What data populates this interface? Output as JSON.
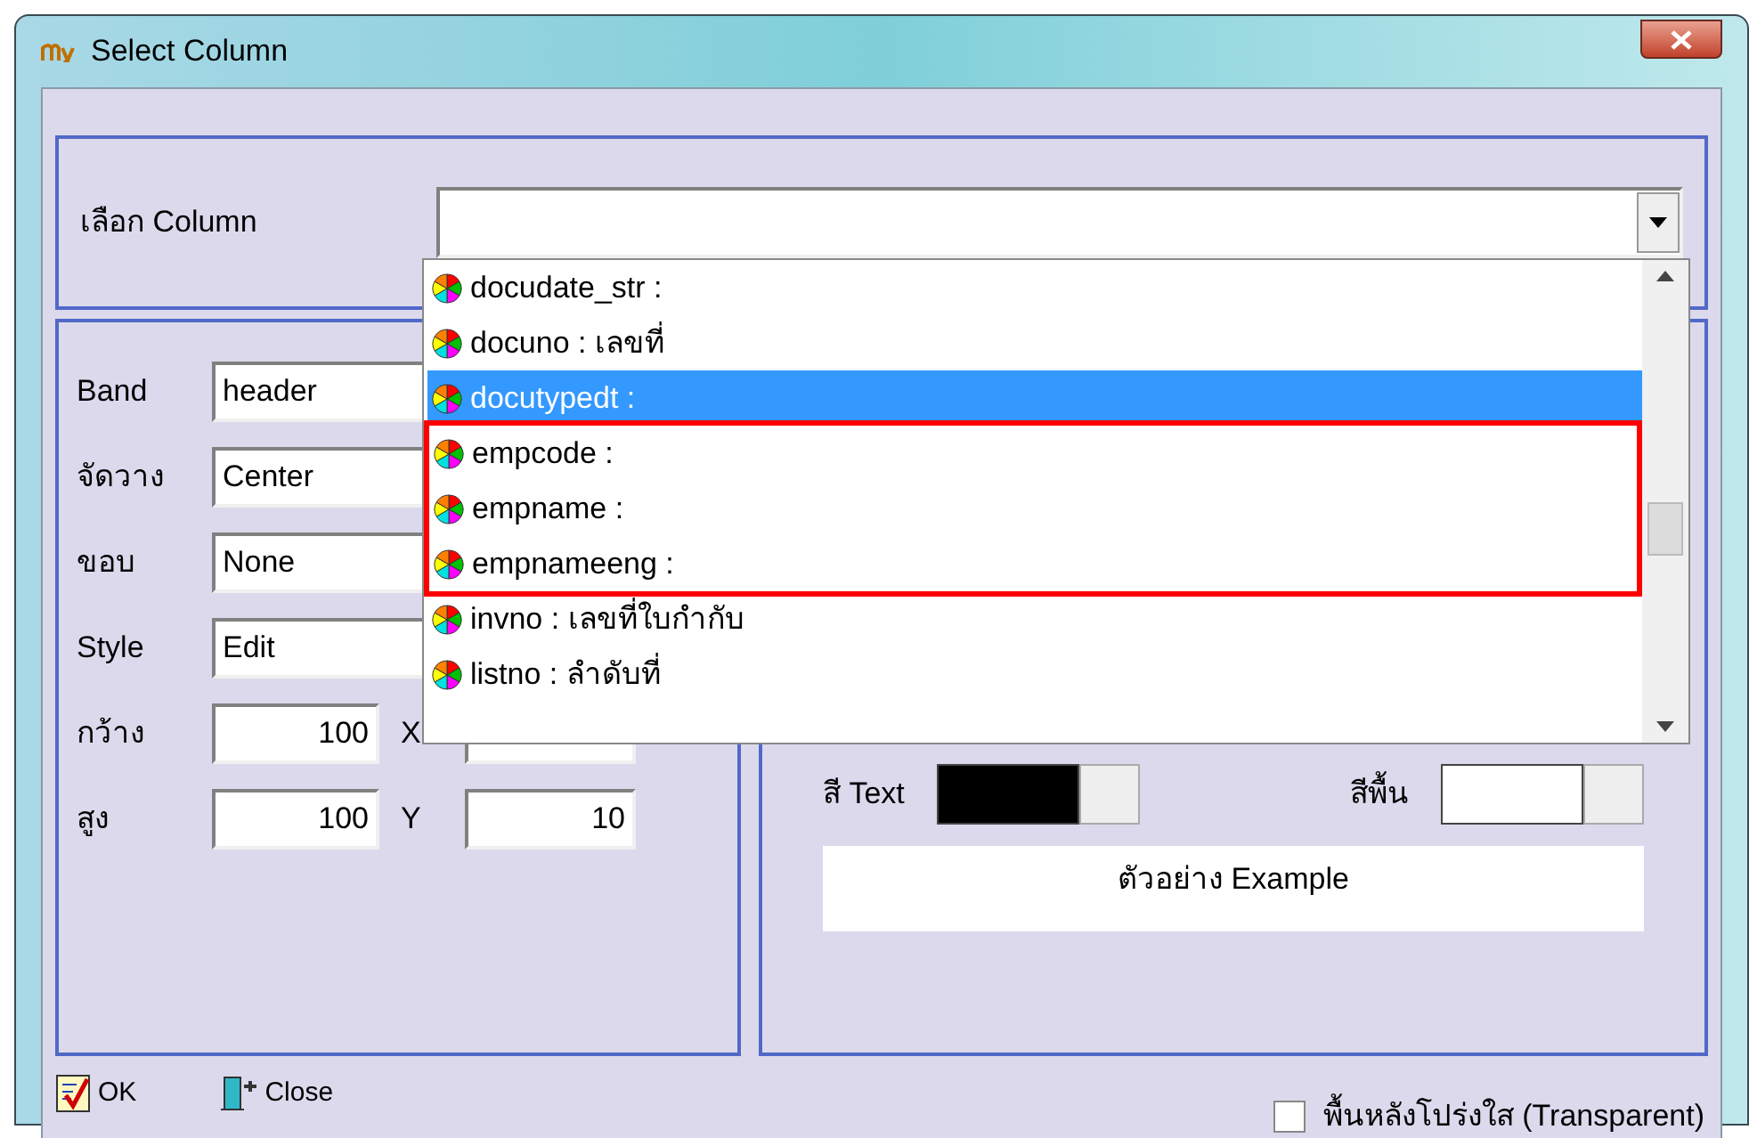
{
  "window": {
    "title": "Select Column"
  },
  "column_select": {
    "label": "เลือก Column"
  },
  "dropdown": {
    "items": [
      {
        "label": "docudate_str :",
        "selected": false,
        "annotated": false
      },
      {
        "label": "docuno :  เลขที่",
        "selected": false,
        "annotated": false
      },
      {
        "label": "docutypedt :",
        "selected": true,
        "annotated": false
      },
      {
        "label": "empcode :",
        "selected": false,
        "annotated": true
      },
      {
        "label": "empname :",
        "selected": false,
        "annotated": true
      },
      {
        "label": "empnameeng :",
        "selected": false,
        "annotated": true
      },
      {
        "label": "invno : เลขที่ใบกำกับ",
        "selected": false,
        "annotated": false
      },
      {
        "label": "listno : ลำดับที่",
        "selected": false,
        "annotated": false
      }
    ]
  },
  "properties": [
    {
      "label": "Band",
      "value": "header"
    },
    {
      "label": "จัดวาง",
      "value": "Center"
    },
    {
      "label": "ขอบ",
      "value": "None"
    },
    {
      "label": "Style",
      "value": "Edit"
    }
  ],
  "size": [
    {
      "label": "กว้าง",
      "value": "100",
      "coord_label": "X"
    },
    {
      "label": "สูง",
      "value": "100",
      "coord_label": "Y",
      "coord_value": "10"
    }
  ],
  "colors": [
    {
      "label": "สี Text",
      "color": "#000000"
    },
    {
      "label": "สีพื้น",
      "color": "#ffffff"
    }
  ],
  "preview": "ตัวอย่าง Example",
  "buttons": [
    {
      "label": "OK",
      "kind": "ok"
    },
    {
      "label": "Close",
      "kind": "close"
    }
  ],
  "transparent": {
    "label": "พื้นหลังโปร่งใส (Transparent)",
    "checked": false
  }
}
